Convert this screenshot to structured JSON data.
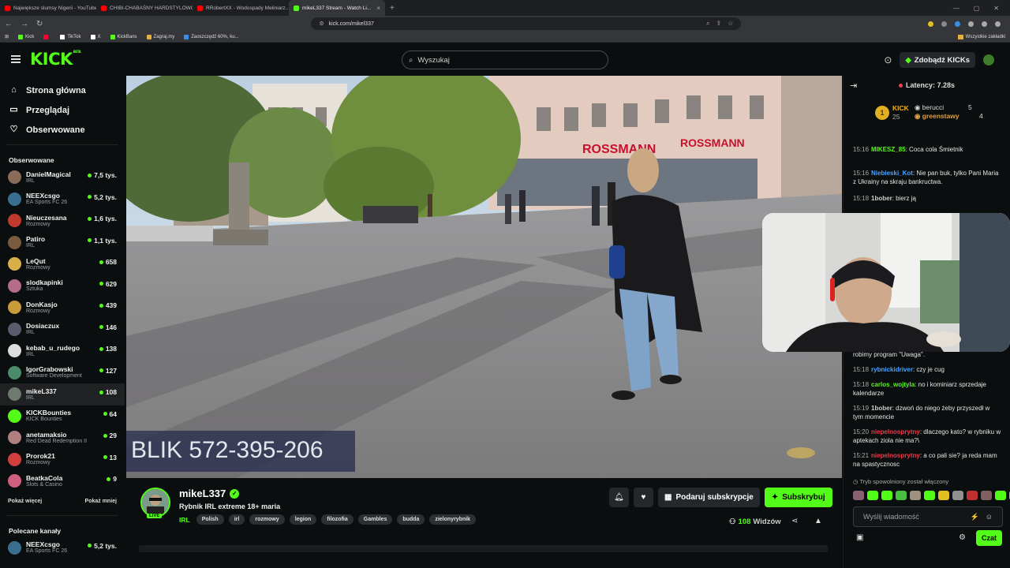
{
  "browser": {
    "tabs": [
      {
        "title": "Największe slumsy Nigerii - YouTube",
        "color": "#ff0000",
        "active": false
      },
      {
        "title": "CHIBI-CHABAŚNY HARDSTYLOWO...",
        "color": "#ff0000",
        "active": false
      },
      {
        "title": "RRobertXX - Wodospady Meliniarz...",
        "color": "#ff0000",
        "active": false
      },
      {
        "title": "mikeL337 Stream - Watch Li...",
        "color": "#53fc18",
        "active": true
      }
    ],
    "url": "kick.com/mikel337",
    "bookmarks": [
      "Kick",
      "",
      "TikTok",
      "X",
      "KickBans",
      "Zagraj.my",
      "Zaoszczędź 60%, ku..."
    ],
    "all_bookmarks": "Wszystkie zakładki"
  },
  "header": {
    "logo": "KICK",
    "logo_sup": "BETA",
    "search_placeholder": "Wyszukaj",
    "get_kicks": "Zdobądź KICKs"
  },
  "sidebar": {
    "nav": [
      {
        "label": "Strona główna",
        "icon": "home-icon"
      },
      {
        "label": "Przeglądaj",
        "icon": "browse-icon"
      },
      {
        "label": "Obserwowane",
        "icon": "heart-icon"
      }
    ],
    "followed_heading": "Obserwowane",
    "followed": [
      {
        "name": "DanielMagical",
        "cat": "IRL",
        "viewers": "7,5 tys.",
        "color": "#8a6b5a"
      },
      {
        "name": "NEEXcsgo",
        "cat": "EA Sports FC 26",
        "viewers": "5,2 tys.",
        "color": "#3a6e8f"
      },
      {
        "name": "Nieuczesana",
        "cat": "Rozmowy",
        "viewers": "1,6 tys.",
        "color": "#c0392b"
      },
      {
        "name": "Patiro",
        "cat": "IRL",
        "viewers": "1,1 tys.",
        "color": "#7a5a3c"
      },
      {
        "name": "LeQut",
        "cat": "Rozmowy",
        "viewers": "658",
        "color": "#d8b04a"
      },
      {
        "name": "slodkapinki",
        "cat": "Sztuka",
        "viewers": "629",
        "color": "#b56b8a"
      },
      {
        "name": "DonKasjo",
        "cat": "Rozmowy",
        "viewers": "439",
        "color": "#c99a3a"
      },
      {
        "name": "Dosiaczux",
        "cat": "IRL",
        "viewers": "146",
        "color": "#5b5b6e"
      },
      {
        "name": "kebab_u_rudego",
        "cat": "IRL",
        "viewers": "138",
        "color": "#ddd"
      },
      {
        "name": "IgorGrabowski",
        "cat": "Software Development",
        "viewers": "127",
        "color": "#4b8b6a"
      },
      {
        "name": "mikeL337",
        "cat": "IRL",
        "viewers": "108",
        "color": "#6d7a6d",
        "selected": true
      },
      {
        "name": "KICKBounties",
        "cat": "KICK Bounties",
        "viewers": "64",
        "color": "#53fc18"
      },
      {
        "name": "anetamaksio",
        "cat": "Red Dead Redemption II",
        "viewers": "29",
        "color": "#b08080"
      },
      {
        "name": "Prorok21",
        "cat": "Rozmowy",
        "viewers": "13",
        "color": "#d04040"
      },
      {
        "name": "BeatkaCola",
        "cat": "Slots & Casino",
        "viewers": "9",
        "color": "#d06080"
      }
    ],
    "show_more": "Pokaż więcej",
    "show_less": "Pokaż mniej",
    "recommended_heading": "Polecane kanały",
    "recommended": [
      {
        "name": "NEEXcsgo",
        "cat": "EA Sports FC 26",
        "viewers": "5,2 tys.",
        "color": "#3a6e8f"
      }
    ]
  },
  "video": {
    "overlay_text": "BLIK 572-395-206",
    "signs": [
      "ROSSMANN",
      "ROSSMANN"
    ]
  },
  "stream": {
    "name": "mikeL337",
    "live": "LIVE",
    "title": "Rybnik IRL extreme 18+ maria",
    "category": "IRL",
    "tags": [
      "Polish",
      "irl",
      "rozmowy",
      "legion",
      "filozofia",
      "Gambles",
      "budda",
      "zielonyrybnik"
    ],
    "gift_sub": "Podaruj subskrypcje",
    "subscribe": "Subskrybuj",
    "viewers_count": "108",
    "viewers_label": "Widzów"
  },
  "chat": {
    "latency": "Latency: 7.28s",
    "leader": {
      "rank": "1",
      "label": "KICK",
      "count": "25",
      "users": [
        {
          "name": "berucci",
          "count": "5"
        },
        {
          "name": "greenstawy",
          "count": "4"
        }
      ]
    },
    "messages": [
      {
        "time": "15:16",
        "user": "MIKESZ_85",
        "color": "#53fc18",
        "text": ": Coca cola Śmietnik"
      },
      {
        "time": "15:16",
        "user": "Niebieski_Kot",
        "color": "#4aa3ff",
        "text": ": Nie pan buk, tylko Pani Maria z Ukrainy na skraju bankructwa."
      },
      {
        "time": "15:18",
        "user": "1bober",
        "color": "#cccccc",
        "text": ": bierz ją"
      },
      {
        "time": "15:18",
        "user": "",
        "color": "#cccccc",
        "text": "robimy program \"Uwaga\"."
      },
      {
        "time": "15:18",
        "user": "rybnickidriver",
        "color": "#4aa3ff",
        "text": ": czy je cug"
      },
      {
        "time": "15:18",
        "user": "carlos_wojtyla",
        "color": "#53fc18",
        "text": ": no i kominiarz sprzedaje kalendarze"
      },
      {
        "time": "15:19",
        "user": "1bober",
        "color": "#cccccc",
        "text": ": dzwoń do niego żeby przyszedł w tym momencie"
      },
      {
        "time": "15:20",
        "user": "niepelnosprytny",
        "color": "#f0384a",
        "text": ": dlaczego kato? w rybniku w aptekach ziola nie ma?\\"
      },
      {
        "time": "15:21",
        "user": "niepelnosprytny",
        "color": "#f0384a",
        "text": ": a co pali sie? ja reda mam na spastycznosc"
      }
    ],
    "slow_mode": "Tryb spowolniony został włączony",
    "input_placeholder": "Wyślij wiadomość",
    "send": "Czat"
  }
}
